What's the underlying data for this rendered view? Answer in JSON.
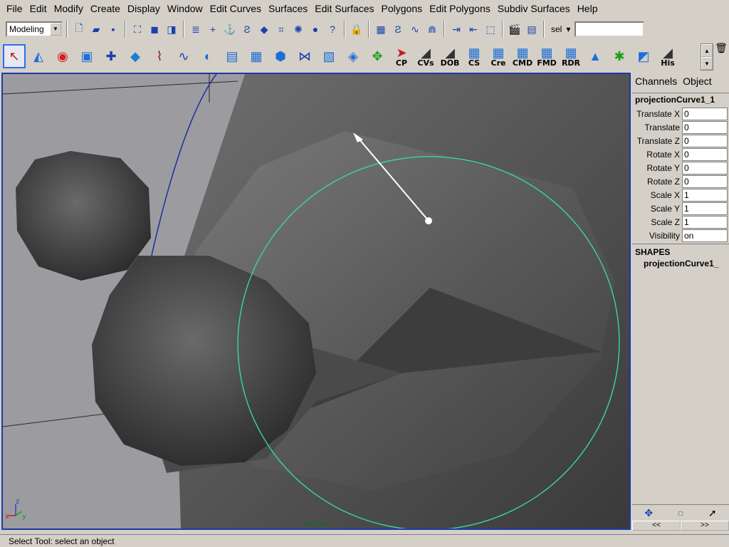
{
  "menubar": {
    "items": [
      "File",
      "Edit",
      "Modify",
      "Create",
      "Display",
      "Window",
      "Edit Curves",
      "Surfaces",
      "Edit Surfaces",
      "Polygons",
      "Edit Polygons",
      "Subdiv Surfaces",
      "Help"
    ]
  },
  "statusline": {
    "mode": "Modeling",
    "sel_label": "sel",
    "sel_value": "",
    "icons": [
      "new-scene-icon",
      "open-scene-icon",
      "save-scene-icon",
      "select-hierarchy-icon",
      "select-object-icon",
      "select-component-icon",
      "snap-grid-icon",
      "snap-curve-icon",
      "snap-point-icon",
      "snap-view-plane-icon",
      "snap-live-icon",
      "history-icon",
      "render-icon",
      "ipr-render-icon",
      "render-globals-icon",
      "lock-icon",
      "input-ops-icon",
      "output-ops-icon"
    ]
  },
  "shelf": {
    "buttons": [
      {
        "name": "select-tool",
        "glyph": "↖",
        "label": "",
        "active": true
      },
      {
        "name": "lasso-tool",
        "glyph": "◭",
        "label": ""
      },
      {
        "name": "rotate-tool",
        "glyph": "◉",
        "label": ""
      },
      {
        "name": "scale-tool",
        "glyph": "▣",
        "label": ""
      },
      {
        "name": "move-tool",
        "glyph": "✚",
        "label": ""
      },
      {
        "name": "manipulator-tool",
        "glyph": "◆",
        "label": ""
      },
      {
        "name": "ep-curve-tool",
        "glyph": "⌇",
        "label": ""
      },
      {
        "name": "cv-curve-tool",
        "glyph": "∿",
        "label": ""
      },
      {
        "name": "revolve",
        "glyph": "◐",
        "label": ""
      },
      {
        "name": "loft",
        "glyph": "▤",
        "label": ""
      },
      {
        "name": "planar",
        "glyph": "▦",
        "label": ""
      },
      {
        "name": "extrude",
        "glyph": "⬢",
        "label": ""
      },
      {
        "name": "birail",
        "glyph": "⋈",
        "label": ""
      },
      {
        "name": "boundary",
        "glyph": "▧",
        "label": ""
      },
      {
        "name": "square",
        "glyph": "◈",
        "label": ""
      },
      {
        "name": "project-curve",
        "glyph": "✥",
        "label": ""
      },
      {
        "name": "cp",
        "glyph": "➤",
        "label": "CP"
      },
      {
        "name": "cvs",
        "glyph": "◢",
        "label": "CVs"
      },
      {
        "name": "dob",
        "glyph": "◢",
        "label": "DOB"
      },
      {
        "name": "cs",
        "glyph": "▦",
        "label": "CS"
      },
      {
        "name": "cre",
        "glyph": "▦",
        "label": "Cre"
      },
      {
        "name": "cmd",
        "glyph": "▦",
        "label": "CMD"
      },
      {
        "name": "fmd",
        "glyph": "▦",
        "label": "FMD"
      },
      {
        "name": "rdr",
        "glyph": "▦",
        "label": "RDR"
      },
      {
        "name": "sculpt",
        "glyph": "▲",
        "label": ""
      },
      {
        "name": "paint-weights",
        "glyph": "✱",
        "label": ""
      },
      {
        "name": "uv-editor",
        "glyph": "◩",
        "label": ""
      },
      {
        "name": "his",
        "glyph": "◢",
        "label": "His"
      }
    ]
  },
  "viewport": {
    "camera": "persp",
    "axis_x": "x",
    "axis_y": "y",
    "axis_z": "z"
  },
  "channelbox": {
    "tabs": [
      "Channels",
      "Object"
    ],
    "object_name": "projectionCurve1_1",
    "attributes": [
      {
        "name": "Translate X",
        "value": "0"
      },
      {
        "name": "Translate",
        "value": "0"
      },
      {
        "name": "Translate Z",
        "value": "0"
      },
      {
        "name": "Rotate X",
        "value": "0"
      },
      {
        "name": "Rotate Y",
        "value": "0"
      },
      {
        "name": "Rotate Z",
        "value": "0"
      },
      {
        "name": "Scale X",
        "value": "1"
      },
      {
        "name": "Scale Y",
        "value": "1"
      },
      {
        "name": "Scale Z",
        "value": "1"
      },
      {
        "name": "Visibility",
        "value": "on"
      }
    ],
    "shapes_header": "SHAPES",
    "shape_name": "projectionCurve1_",
    "nav_prev": "<<",
    "nav_next": ">>"
  },
  "helpline": {
    "text": "Select Tool: select an object"
  },
  "colors": {
    "accent": "#2d6cf6",
    "viewport_border": "#1b3aa8",
    "curve": "#38d6a6",
    "background": "#d4d0c8"
  }
}
